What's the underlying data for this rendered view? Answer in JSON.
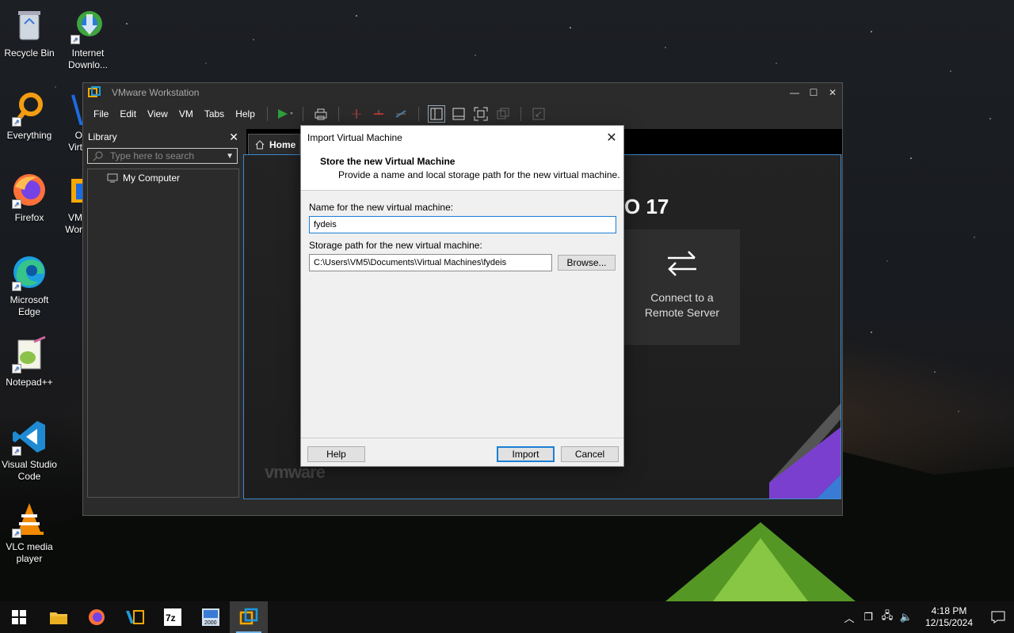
{
  "desktop": {
    "icons": [
      {
        "label": "Recycle Bin",
        "icon": "recycle-bin-icon"
      },
      {
        "label": "Everything",
        "icon": "everything-icon"
      },
      {
        "label": "Firefox",
        "icon": "firefox-icon"
      },
      {
        "label": "Microsoft Edge",
        "icon": "edge-icon"
      },
      {
        "label": "Notepad++",
        "icon": "notepadpp-icon"
      },
      {
        "label": "Visual Studio Code",
        "icon": "vscode-icon"
      },
      {
        "label": "VLC media player",
        "icon": "vlc-icon"
      }
    ],
    "icons_col2": [
      {
        "label": "Internet Downlo...",
        "icon": "idm-icon"
      },
      {
        "label": "O Virt",
        "icon": "virtualbox-icon"
      },
      {
        "label": "VM Wor",
        "icon": "vmware-icon"
      }
    ]
  },
  "vmware": {
    "title": "VMware Workstation",
    "menu": [
      "File",
      "Edit",
      "View",
      "VM",
      "Tabs",
      "Help"
    ],
    "library": {
      "title": "Library",
      "search_placeholder": "Type here to search",
      "tree": [
        "My Computer"
      ]
    },
    "tabs": [
      {
        "label": "Home"
      }
    ],
    "home": {
      "brand_fragment": "O 17",
      "tile_label": "Connect to a Remote Server",
      "logo_text": "vmware"
    }
  },
  "dialog": {
    "title": "Import Virtual Machine",
    "heading": "Store the new Virtual Machine",
    "subheading": "Provide a name and local storage path for the new virtual machine.",
    "name_label": "Name for the new virtual machine:",
    "name_value": "fydeis",
    "path_label": "Storage path for the new virtual machine:",
    "path_value": "C:\\Users\\VM5\\Documents\\Virtual Machines\\fydeis",
    "browse_label": "Browse...",
    "help_label": "Help",
    "import_label": "Import",
    "cancel_label": "Cancel"
  },
  "taskbar": {
    "time": "4:18 PM",
    "date": "12/15/2024",
    "apps": [
      "file-explorer-icon",
      "firefox-icon",
      "visual-studio-icon",
      "7zip-icon",
      "win2000-icon",
      "vmware-icon"
    ]
  },
  "colors": {
    "accent": "#1a7fd4",
    "vm_dark": "#2b2b2b",
    "taskbar": "#101010"
  }
}
